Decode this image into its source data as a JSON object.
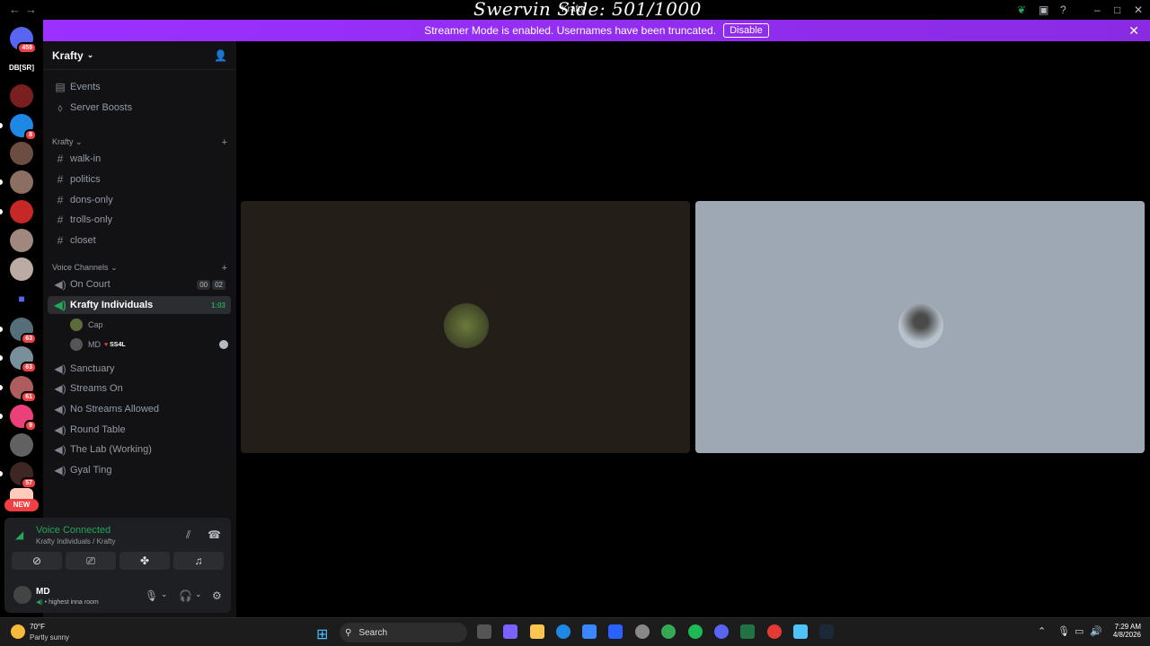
{
  "titlebar": {
    "overlay_text": "Swervin Side: 501/1000",
    "app_title": "Krafty",
    "back": "←",
    "forward": "→"
  },
  "banner": {
    "message": "Streamer Mode is enabled. Usernames have been truncated.",
    "disable_label": "Disable"
  },
  "servers": {
    "top_badge": "459",
    "label_dbsr": "DB[SR]",
    "badges": [
      "8",
      "63",
      "63",
      "61",
      "9",
      "57"
    ],
    "new_label": "NEW"
  },
  "sidebar": {
    "server_name": "Krafty",
    "top_items": [
      {
        "label": "Events",
        "icon": "calendar-icon"
      },
      {
        "label": "Server Boosts",
        "icon": "boost-icon"
      }
    ],
    "text_category": "Krafty",
    "text_channels": [
      "walk-in",
      "politics",
      "dons-only",
      "trolls-only",
      "closet"
    ],
    "voice_category": "Voice Channels",
    "voice_channels": [
      {
        "label": "On Court",
        "counts": [
          "00",
          "02"
        ]
      },
      {
        "label": "Krafty Individuals",
        "timer": "1:03",
        "active": true
      },
      {
        "label": "Sanctuary"
      },
      {
        "label": "Streams On"
      },
      {
        "label": "No Streams Allowed"
      },
      {
        "label": "Round Table"
      },
      {
        "label": "The Lab (Working)"
      },
      {
        "label": "Gyal Ting"
      }
    ],
    "members": [
      {
        "name": "Cap"
      },
      {
        "name": "MD",
        "tag": "SS4L"
      }
    ]
  },
  "voice_panel": {
    "status": "Voice Connected",
    "location": "Krafty Individuals / Krafty",
    "user_name": "MD",
    "user_status": "highest inna room"
  },
  "taskbar": {
    "temp": "70°F",
    "condition": "Partly sunny",
    "search_placeholder": "Search",
    "time": "7:29 AM",
    "date": "4/8/2026"
  },
  "colors": {
    "banner": "#8a2be2",
    "voice_green": "#23a55a",
    "tile_left": "#231e18",
    "tile_right": "#9ea8b4"
  }
}
